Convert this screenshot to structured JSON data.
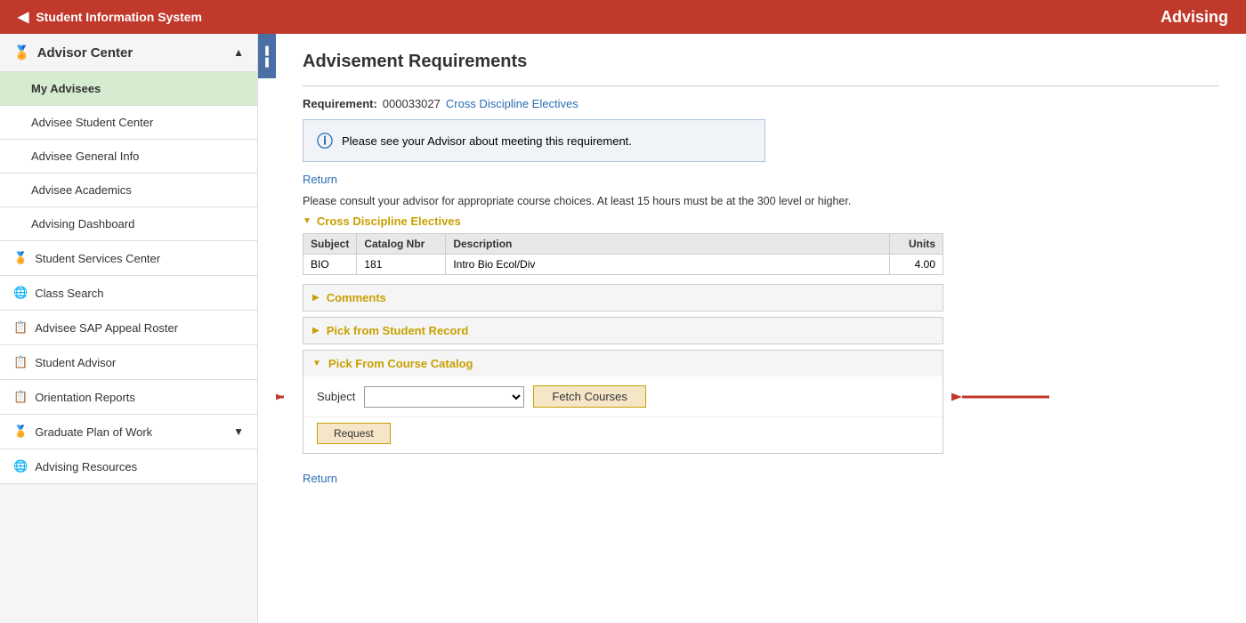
{
  "topBar": {
    "systemName": "Student Information System",
    "pageTitle": "Advising",
    "backLabel": "◀"
  },
  "sidebar": {
    "advisorCenter": {
      "label": "Advisor Center",
      "icon": "🏅"
    },
    "items": [
      {
        "id": "my-advisees",
        "label": "My Advisees",
        "active": true,
        "icon": null,
        "iconType": "none"
      },
      {
        "id": "advisee-student-center",
        "label": "Advisee Student Center",
        "active": false,
        "icon": null,
        "iconType": "none"
      },
      {
        "id": "advisee-general-info",
        "label": "Advisee General Info",
        "active": false,
        "icon": null,
        "iconType": "none"
      },
      {
        "id": "advisee-academics",
        "label": "Advisee Academics",
        "active": false,
        "icon": null,
        "iconType": "none"
      },
      {
        "id": "advising-dashboard",
        "label": "Advising Dashboard",
        "active": false,
        "icon": null,
        "iconType": "none"
      }
    ],
    "groupItems": [
      {
        "id": "student-services-center",
        "label": "Student Services Center",
        "icon": "🏅",
        "iconType": "gold"
      },
      {
        "id": "class-search",
        "label": "Class Search",
        "icon": "🌐",
        "iconType": "globe"
      },
      {
        "id": "advisee-sap-appeal-roster",
        "label": "Advisee SAP Appeal Roster",
        "icon": "📋",
        "iconType": "blue"
      },
      {
        "id": "student-advisor",
        "label": "Student Advisor",
        "icon": "📋",
        "iconType": "blue"
      },
      {
        "id": "orientation-reports",
        "label": "Orientation Reports",
        "icon": "📋",
        "iconType": "blue"
      },
      {
        "id": "graduate-plan-of-work",
        "label": "Graduate Plan of Work",
        "icon": "🏅",
        "iconType": "gold",
        "hasChevron": true
      },
      {
        "id": "advising-resources",
        "label": "Advising Resources",
        "icon": "🌐",
        "iconType": "globe"
      }
    ]
  },
  "content": {
    "pageTitle": "Advisement Requirements",
    "requirement": {
      "label": "Requirement:",
      "id": "000033027",
      "linkText": "Cross Discipline Electives"
    },
    "infoMessage": "Please see your Advisor about meeting this requirement.",
    "returnLabel": "Return",
    "advisoryText": "Please consult your advisor for appropriate course choices. At least 15 hours must be at the 300 level or higher.",
    "sectionName": "Cross Discipline Electives",
    "table": {
      "headers": [
        "Subject",
        "Catalog Nbr",
        "Description",
        "Units"
      ],
      "rows": [
        {
          "subject": "BIO",
          "catalogNbr": "181",
          "description": "Intro Bio Ecol/Div",
          "units": "4.00"
        }
      ]
    },
    "collapsibleSections": [
      {
        "id": "comments",
        "label": "Comments",
        "expanded": false
      },
      {
        "id": "pick-from-student-record",
        "label": "Pick from Student Record",
        "expanded": false
      }
    ],
    "catalogSection": {
      "label": "Pick From Course Catalog",
      "subjectLabel": "Subject",
      "fetchButtonLabel": "Fetch Courses",
      "requestButtonLabel": "Request"
    },
    "returnBottomLabel": "Return"
  },
  "collapsePanel": {
    "icon": "❚❚"
  }
}
